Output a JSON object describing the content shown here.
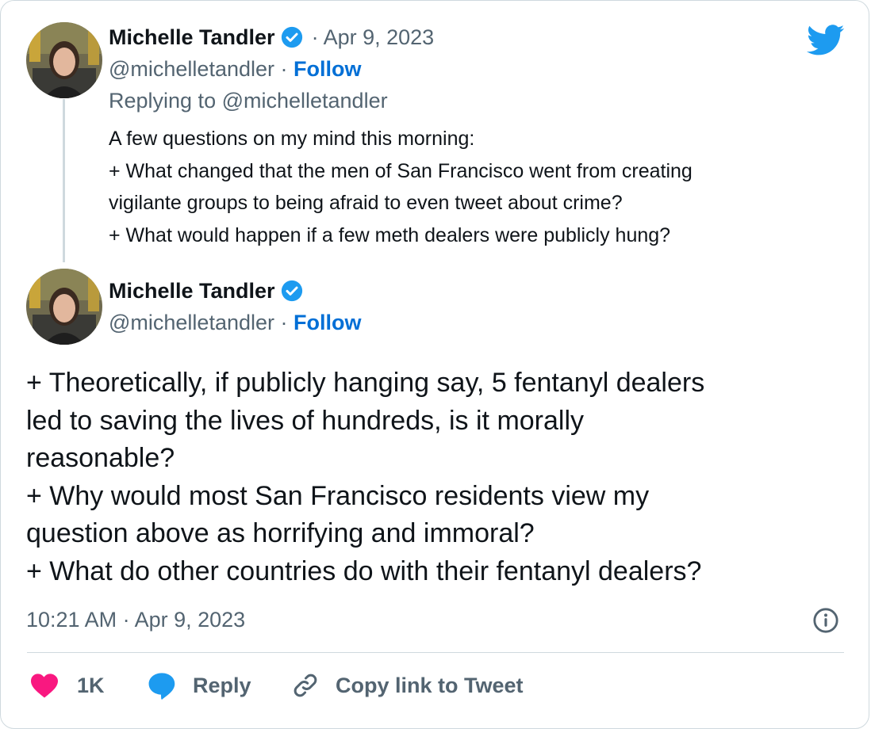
{
  "first_tweet": {
    "author_name": "Michelle Tandler",
    "date": "· Apr 9, 2023",
    "handle": "@michelletandler",
    "separator": "·",
    "follow_label": "Follow",
    "replying_to": "Replying to @michelletandler",
    "lines": [
      "A few questions on my mind this morning:",
      "+ What changed that the men of San Francisco went from creating",
      "vigilante groups to being afraid to even tweet about crime?",
      "+ What would happen if a few meth dealers were publicly hung?"
    ]
  },
  "main_tweet": {
    "author_name": "Michelle Tandler",
    "handle": "@michelletandler",
    "separator": "·",
    "follow_label": "Follow",
    "lines": [
      "+ Theoretically, if publicly hanging say, 5 fentanyl dealers",
      "led to saving the lives of hundreds, is it morally",
      "reasonable?",
      "+ Why would most San Francisco residents view my",
      "question above as horrifying and immoral?",
      "+ What do other countries do with their fentanyl dealers?"
    ],
    "timestamp": "10:21 AM · Apr 9, 2023"
  },
  "actions": {
    "like_count": "1K",
    "reply_label": "Reply",
    "copy_link_label": "Copy link to Tweet"
  },
  "icons": {
    "brand": "twitter-bird-icon",
    "verified": "verified-badge-icon",
    "info": "info-icon",
    "like": "heart-icon",
    "reply": "speech-bubble-icon",
    "link": "link-icon"
  },
  "colors": {
    "twitter_blue": "#1d9bf0",
    "follow_blue": "#006fd6",
    "like_pink": "#f91880",
    "secondary_text": "#536471",
    "primary_text": "#0f1419",
    "border": "#cfd9de"
  }
}
